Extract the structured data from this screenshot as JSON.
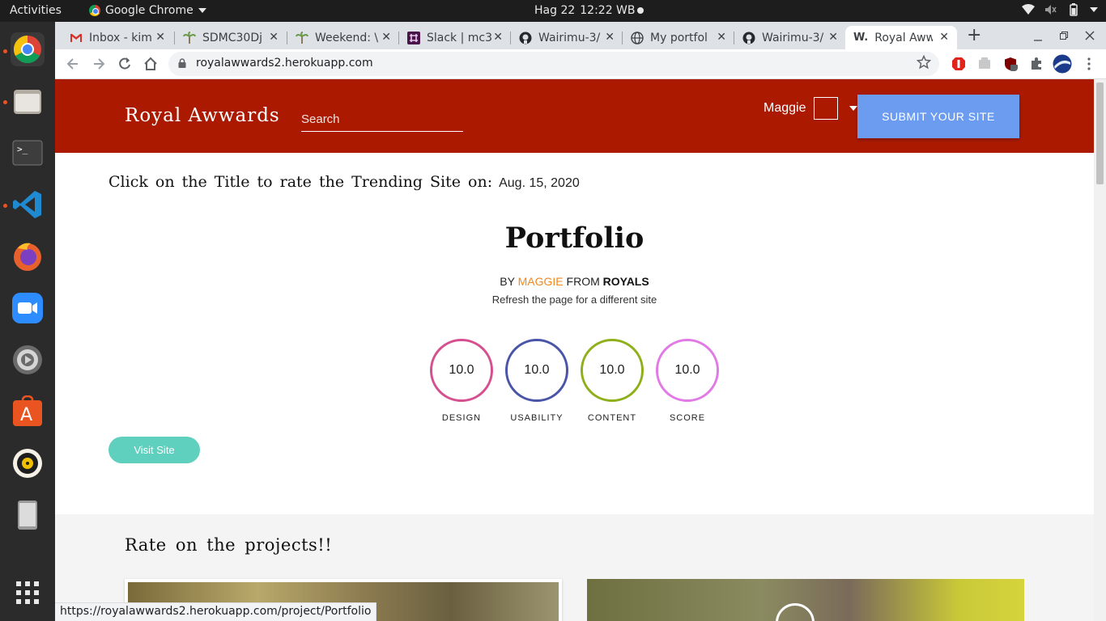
{
  "system": {
    "activities": "Activities",
    "app_name": "Google Chrome",
    "date": "Hag 22",
    "time": "12:22 WB",
    "tray_icons": [
      "wifi-icon",
      "volume-icon",
      "battery-icon",
      "power-icon"
    ]
  },
  "dock": {
    "items": [
      "chrome-icon",
      "files-icon",
      "terminal-icon",
      "vscode-icon",
      "firefox-icon",
      "zoom-icon",
      "settings-icon",
      "software-icon",
      "rhythmbox-icon",
      "tablet-icon",
      "app-grid-icon"
    ]
  },
  "browser": {
    "tabs": [
      {
        "title": "Inbox - kim",
        "icon": "gmail-icon"
      },
      {
        "title": "SDMC30Dj",
        "icon": "palm-icon"
      },
      {
        "title": "Weekend: \\",
        "icon": "palm-icon"
      },
      {
        "title": "Slack | mc3",
        "icon": "slack-icon"
      },
      {
        "title": "Wairimu-3/",
        "icon": "github-icon"
      },
      {
        "title": "My portfol",
        "icon": "globe-icon"
      },
      {
        "title": "Wairimu-3/",
        "icon": "github-icon"
      },
      {
        "title": "Royal Aww",
        "icon": "w-icon",
        "active": true
      }
    ],
    "favicon_w": "W.",
    "close_glyph": "✕",
    "new_tab": "+",
    "url": "royalawwards2.herokuapp.com",
    "status_url": "https://royalawwards2.herokuapp.com/project/Portfolio"
  },
  "site": {
    "brand": "Royal Awwards",
    "search_placeholder": "Search",
    "username": "Maggie",
    "submit_label": "SUBMIT YOUR SITE",
    "rate_prompt": "Click on the Title to rate the Trending Site on:",
    "date": "Aug. 15, 2020",
    "title": "Portfolio",
    "by": "BY",
    "author": "MAGGIE",
    "from": "FROM",
    "org": "ROYALS",
    "refresh_hint": "Refresh the page for a different site",
    "scores": [
      {
        "value": "10.0",
        "label": "DESIGN",
        "color": "#d4508f"
      },
      {
        "value": "10.0",
        "label": "USABILITY",
        "color": "#4a55a8"
      },
      {
        "value": "10.0",
        "label": "CONTENT",
        "color": "#8fb01a"
      },
      {
        "value": "10.0",
        "label": "SCORE",
        "color": "#e27ae6"
      }
    ],
    "visit_label": "Visit Site",
    "projects_title": "Rate on the projects!!"
  },
  "colors": {
    "header": "#ab1a00",
    "submit": "#6b9cf0",
    "visit": "#5fcfbe",
    "author": "#f0891e"
  }
}
